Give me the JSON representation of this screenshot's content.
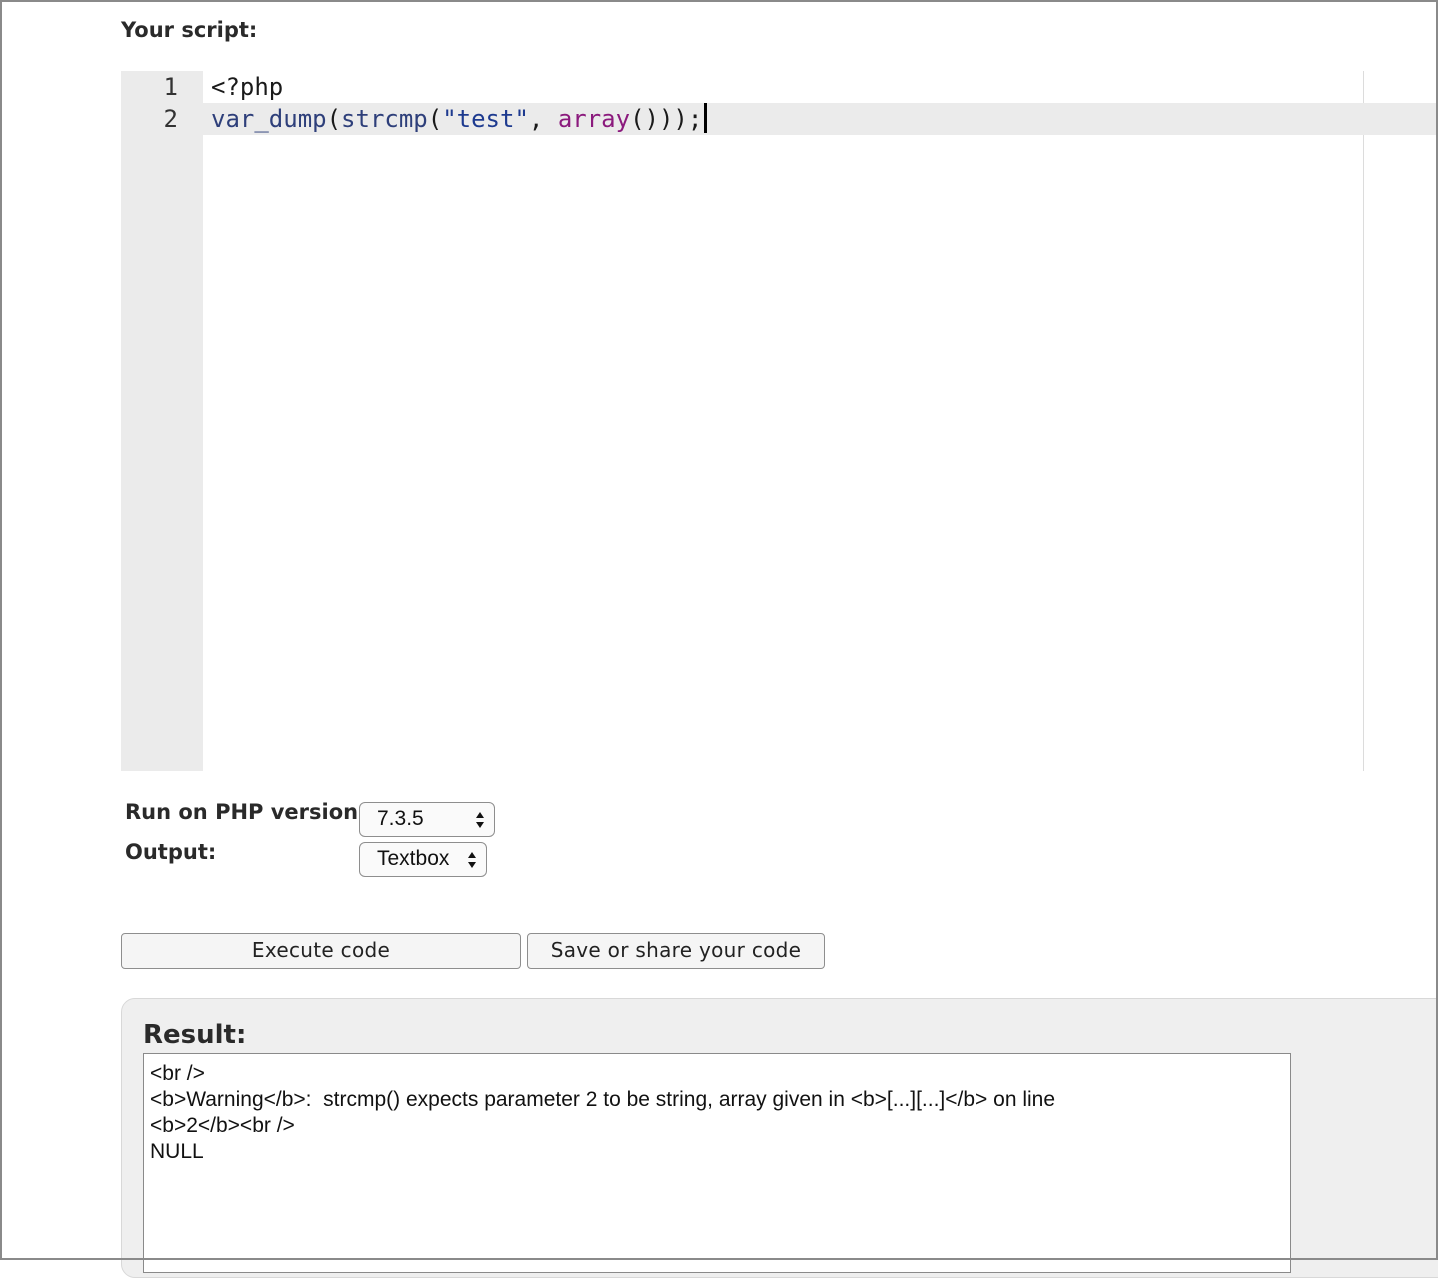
{
  "script_label": "Your script:",
  "editor": {
    "lines": [
      {
        "number": "1",
        "tokens": {
          "open_tag": "<?php"
        }
      },
      {
        "number": "2",
        "tokens": {
          "fn1": "var_dump",
          "p1": "(",
          "fn2": "strcmp",
          "p2": "(",
          "str": "\"test\"",
          "comma": ", ",
          "kw": "array",
          "tail": "()));"
        }
      }
    ],
    "active_line": 2
  },
  "options": {
    "php_version_label": "Run on PHP version:",
    "php_version_value": "7.3.5",
    "output_label": "Output:",
    "output_value": "Textbox"
  },
  "buttons": {
    "execute": "Execute code",
    "save_share": "Save or share your code"
  },
  "result": {
    "title": "Result:",
    "output": "<br />\n<b>Warning</b>:  strcmp() expects parameter 2 to be string, array given in <b>[...][...]</b> on line\n<b>2</b><br />\nNULL"
  },
  "colors": {
    "gutter": "#ebebeb",
    "active_line": "#ebebeb",
    "function": "#2e3f7a",
    "string": "#1d3a8f",
    "keyword": "#8b1a7d",
    "result_panel": "#efefef"
  },
  "icons": {
    "select_arrows": "updown-arrows-icon"
  }
}
